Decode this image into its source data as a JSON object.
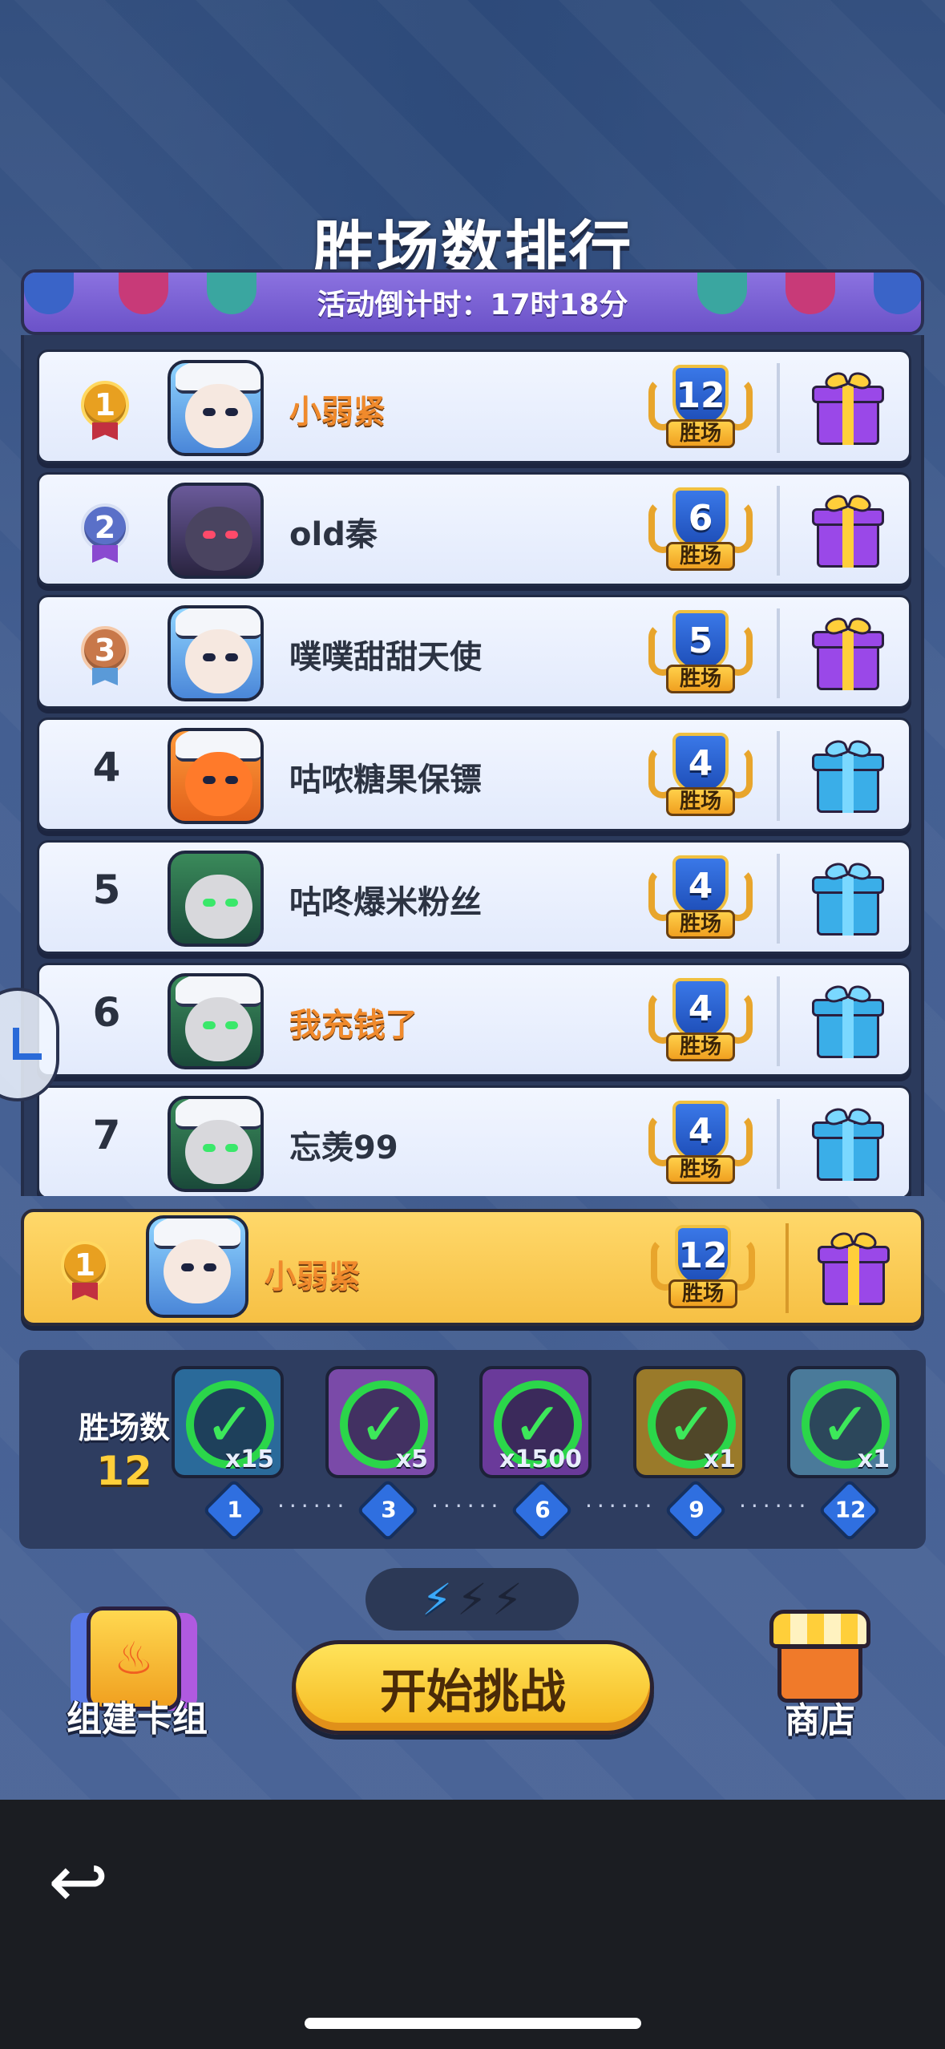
{
  "title": "胜场数排行",
  "banner": {
    "countdown": "活动倒计时：17时18分"
  },
  "rows": [
    {
      "rank": "1",
      "name": "小弱紧",
      "wins": "12",
      "wins_label": "胜场",
      "gift": "purple-gift-icon",
      "highlight_name": true
    },
    {
      "rank": "2",
      "name": "old秦",
      "wins": "6",
      "wins_label": "胜场",
      "gift": "purple-gift-icon",
      "highlight_name": false
    },
    {
      "rank": "3",
      "name": "噗噗甜甜天使",
      "wins": "5",
      "wins_label": "胜场",
      "gift": "purple-gift-icon",
      "highlight_name": false
    },
    {
      "rank": "4",
      "name": "咕哝糖果保镖",
      "wins": "4",
      "wins_label": "胜场",
      "gift": "blue-gift-icon",
      "highlight_name": false
    },
    {
      "rank": "5",
      "name": "咕咚爆米粉丝",
      "wins": "4",
      "wins_label": "胜场",
      "gift": "blue-gift-icon",
      "highlight_name": false
    },
    {
      "rank": "6",
      "name": "我充钱了",
      "wins": "4",
      "wins_label": "胜场",
      "gift": "blue-gift-icon",
      "highlight_name": true
    },
    {
      "rank": "7",
      "name": "忘羡99",
      "wins": "4",
      "wins_label": "胜场",
      "gift": "blue-gift-icon",
      "highlight_name": false
    }
  ],
  "my_row": {
    "rank": "1",
    "name": "小弱紧",
    "wins": "12",
    "wins_label": "胜场",
    "gift": "purple-gift-icon"
  },
  "progress": {
    "label": "胜场数",
    "value": "12",
    "rewards": [
      {
        "qty": "x15",
        "claimed": true,
        "color": "#2a6a9a"
      },
      {
        "qty": "x5",
        "claimed": true,
        "color": "#7a4aa8"
      },
      {
        "qty": "x1500",
        "claimed": true,
        "color": "#6a3a9a"
      },
      {
        "qty": "x1",
        "claimed": true,
        "color": "#9a7a2a"
      },
      {
        "qty": "x1",
        "claimed": true,
        "color": "#4a7a9a"
      }
    ],
    "milestones": [
      "1",
      "3",
      "6",
      "9",
      "12"
    ],
    "check_glyph": "✓"
  },
  "energy": {
    "filled": 1,
    "total": 3,
    "bolt_glyph": "⚡"
  },
  "buttons": {
    "deck": "组建卡组",
    "start": "开始挑战",
    "shop": "商店"
  },
  "nav": {
    "back_icon": "back-arrow-icon",
    "back_glyph": "↩"
  },
  "colors": {
    "background": "#3f5b8c",
    "banner": "#7a62d8",
    "row_bg": "#eaf0ff",
    "my_row_bg": "#f8cc55",
    "gold": "#ffcf3a",
    "check_green": "#2bd64a"
  }
}
